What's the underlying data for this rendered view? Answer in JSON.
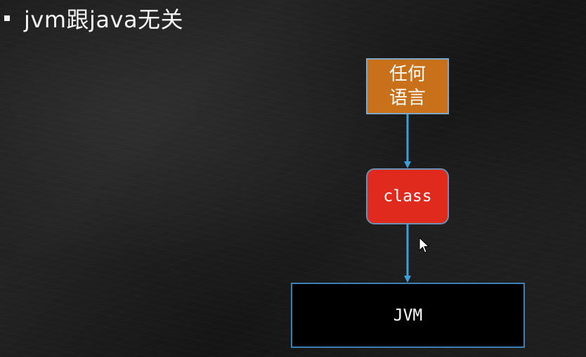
{
  "slide": {
    "title": "jvm跟java无关"
  },
  "diagram": {
    "nodes": {
      "any_language": "任何\n语言",
      "class": "class",
      "jvm": "JVM"
    },
    "colors": {
      "any_language_fill": "#c8701a",
      "class_fill": "#e02a1e",
      "jvm_fill": "#000000",
      "arrow": "#3aa0dc"
    },
    "edges": [
      {
        "from": "any_language",
        "to": "class"
      },
      {
        "from": "class",
        "to": "jvm"
      }
    ]
  }
}
